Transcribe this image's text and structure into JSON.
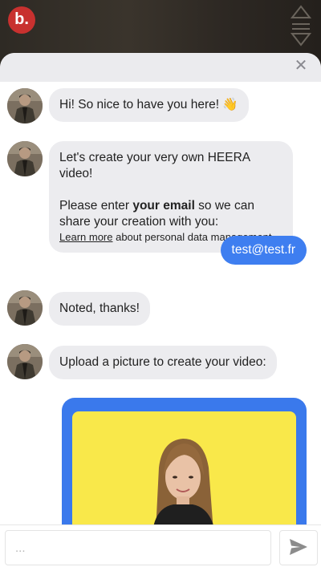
{
  "brand": {
    "logo_letter": "b."
  },
  "chat": {
    "messages": [
      {
        "sender": "bot",
        "text": "Hi! So nice to have you here! 👋"
      },
      {
        "sender": "bot",
        "line1": "Let's create your very own HEERA video!",
        "line2_pre": "Please enter ",
        "line2_bold": "your email",
        "line2_post": " so we can share your creation with you:",
        "link_text": "Learn more",
        "link_suffix": " about personal data management"
      },
      {
        "sender": "user",
        "text": "test@test.fr"
      },
      {
        "sender": "bot",
        "text": "Noted, thanks!"
      },
      {
        "sender": "bot",
        "text": "Upload a picture to create your video:"
      }
    ]
  },
  "composer": {
    "placeholder": "...",
    "value": ""
  },
  "colors": {
    "user_bubble": "#3e7ef0",
    "upload_frame": "#3a79ec",
    "upload_background": "#f9e84a",
    "bot_bubble": "#ececef"
  },
  "icons": {
    "close": "close-icon",
    "send": "send-icon"
  }
}
